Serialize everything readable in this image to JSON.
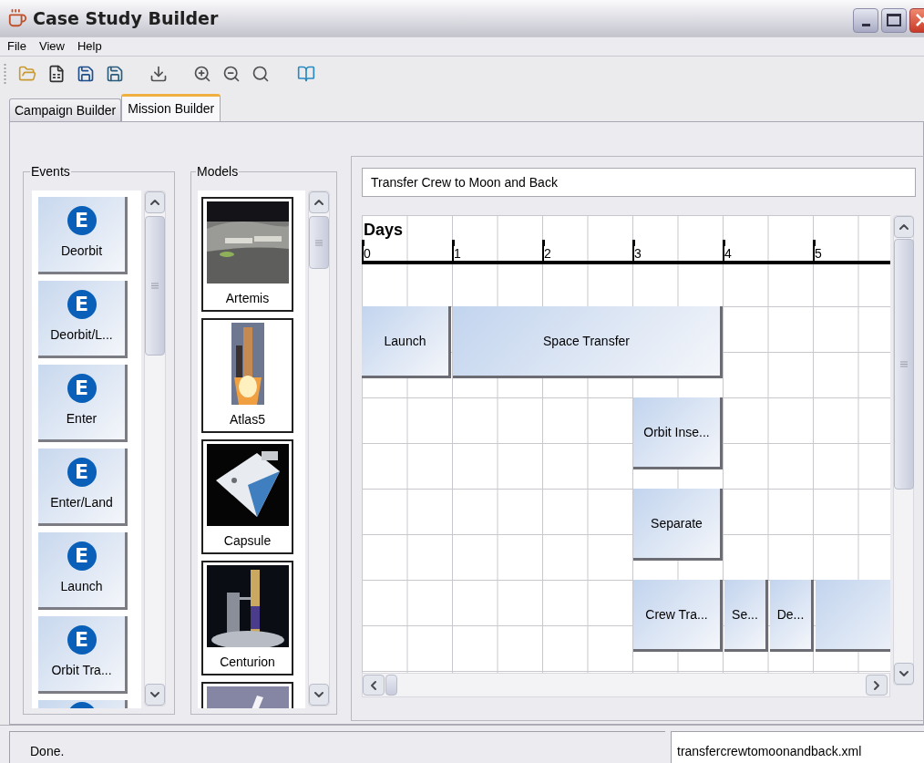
{
  "window": {
    "title": "Case Study Builder"
  },
  "menu": [
    {
      "label": "File"
    },
    {
      "label": "View"
    },
    {
      "label": "Help"
    }
  ],
  "tabs": [
    {
      "label": "Campaign Builder",
      "selected": false
    },
    {
      "label": "Mission Builder",
      "selected": true
    }
  ],
  "events_panel": {
    "title": "Events",
    "items": [
      {
        "kind": "full",
        "icon": "E",
        "label": "Deorbit"
      },
      {
        "kind": "full",
        "icon": "E",
        "label": "Deorbit/L..."
      },
      {
        "kind": "full",
        "icon": "E",
        "label": "Enter"
      },
      {
        "kind": "full",
        "icon": "E",
        "label": "Enter/Land"
      },
      {
        "kind": "full",
        "icon": "E",
        "label": "Launch"
      },
      {
        "kind": "full",
        "icon": "E",
        "label": "Orbit Tra..."
      },
      {
        "kind": "partial"
      }
    ]
  },
  "models_panel": {
    "title": "Models",
    "items": [
      {
        "kind": "picture",
        "label": "Artemis"
      },
      {
        "kind": "picture",
        "label": "Atlas5"
      },
      {
        "kind": "picture",
        "label": "Capsule"
      },
      {
        "kind": "picture",
        "label": "Centurion"
      },
      {
        "kind": "picture"
      }
    ]
  },
  "mission": {
    "name": "Transfer Crew to Moon and Back",
    "axis_label": "Days",
    "ticks": [
      "0",
      "1",
      "2",
      "3",
      "4",
      "5"
    ],
    "lanes": [
      {
        "events": [
          {
            "label": "Launch"
          },
          {
            "label": "Space Transfer"
          }
        ]
      },
      {
        "events": [
          {
            "label": "Orbit Inse..."
          }
        ]
      },
      {
        "events": [
          {
            "label": "Separate"
          }
        ]
      },
      {
        "events": [
          {
            "label": "Crew Tra..."
          },
          {
            "label": "Se..."
          },
          {
            "label": "De..."
          }
        ]
      }
    ]
  },
  "status_bar": {
    "message": "Done.",
    "file": "transfercrewtomoonandback.xml"
  }
}
